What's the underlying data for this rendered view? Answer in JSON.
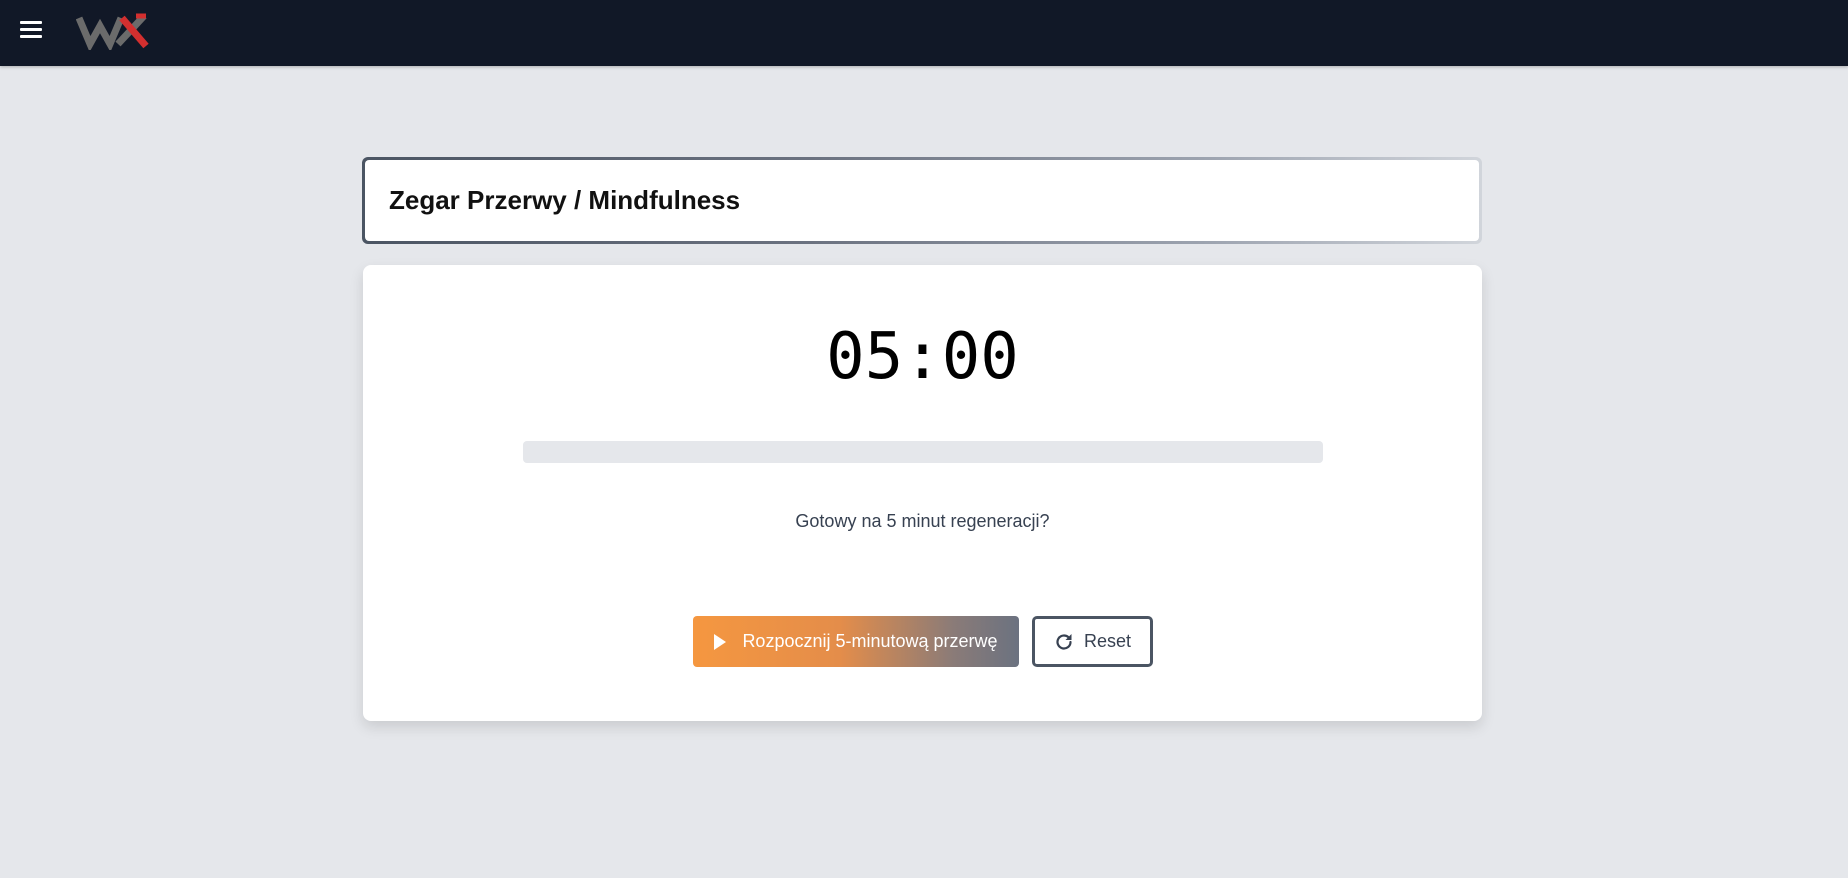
{
  "header": {
    "menu_icon": "hamburger-menu-icon",
    "logo_text": "WX",
    "colors": {
      "background": "#111827",
      "logo_gray": "#6b6b6b",
      "logo_red": "#d32f2f"
    }
  },
  "title_card": {
    "title": "Zegar Przerwy / Mindfulness"
  },
  "timer": {
    "time": "05:00",
    "progress": 0,
    "status": "Gotowy na 5 minut regeneracji?",
    "start_label": "Rozpocznij 5-minutową przerwę",
    "start_icon": "play-icon",
    "reset_label": "Reset",
    "reset_icon": "refresh-icon"
  },
  "colors": {
    "page_background": "#e5e7eb",
    "accent": "#f59740",
    "track": "#e5e7eb"
  }
}
